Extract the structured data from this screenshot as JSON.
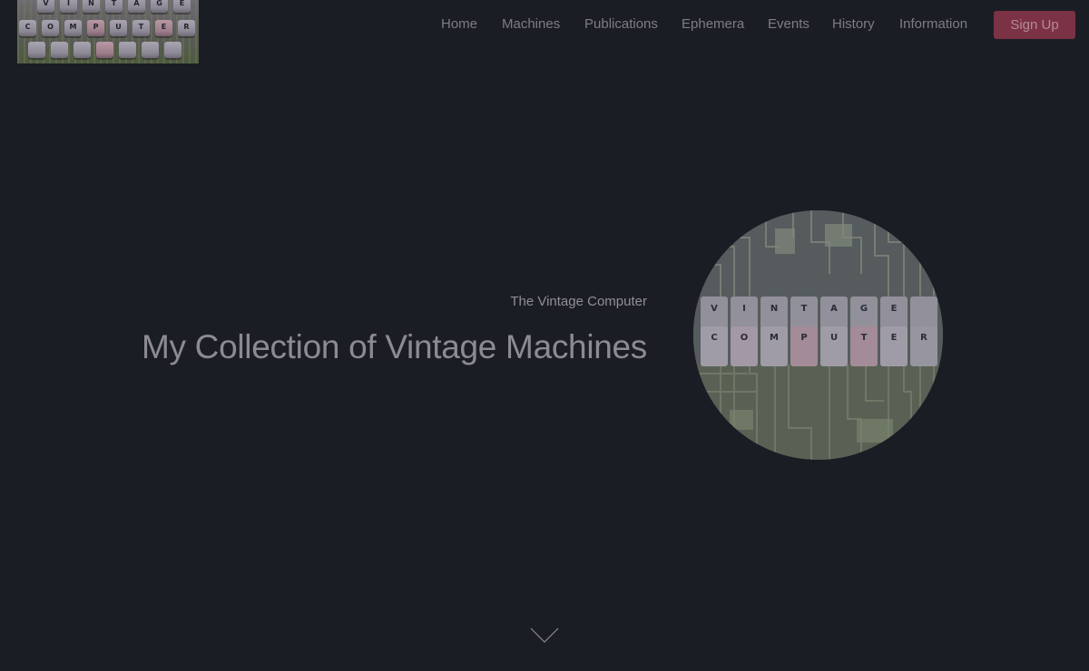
{
  "logo": {
    "row1_keys": [
      "V",
      "I",
      "N",
      "T",
      "A",
      "G",
      "E"
    ],
    "row2_keys": [
      "C",
      "O",
      "M",
      "P",
      "U",
      "T",
      "E",
      "R"
    ],
    "icon": "vintage-computer-keyboard-logo"
  },
  "nav": {
    "items": [
      {
        "label": "Home"
      },
      {
        "label": "Machines"
      },
      {
        "label": "Publications"
      },
      {
        "label": "Ephemera"
      },
      {
        "label": "Events"
      },
      {
        "label": "History"
      },
      {
        "label": "Information"
      }
    ],
    "signup_label": "Sign Up"
  },
  "hero": {
    "subtitle": "The Vintage Computer",
    "title": "My Collection of Vintage Machines",
    "image_icon": "vintage-computer-keys-circuit-image",
    "circle_keys_row1": [
      "V",
      "I",
      "N",
      "T",
      "A",
      "G",
      "E"
    ],
    "circle_keys_row2": [
      "C",
      "O",
      "M",
      "P",
      "U",
      "T",
      "E",
      "R"
    ]
  },
  "scroll": {
    "icon": "chevron-down-icon"
  },
  "colors": {
    "background": "#1b1d25",
    "nav_text": "#7d7d84",
    "signup_bg": "#7b3245",
    "signup_text": "#b58b97",
    "heading_text": "#8b8b91"
  }
}
